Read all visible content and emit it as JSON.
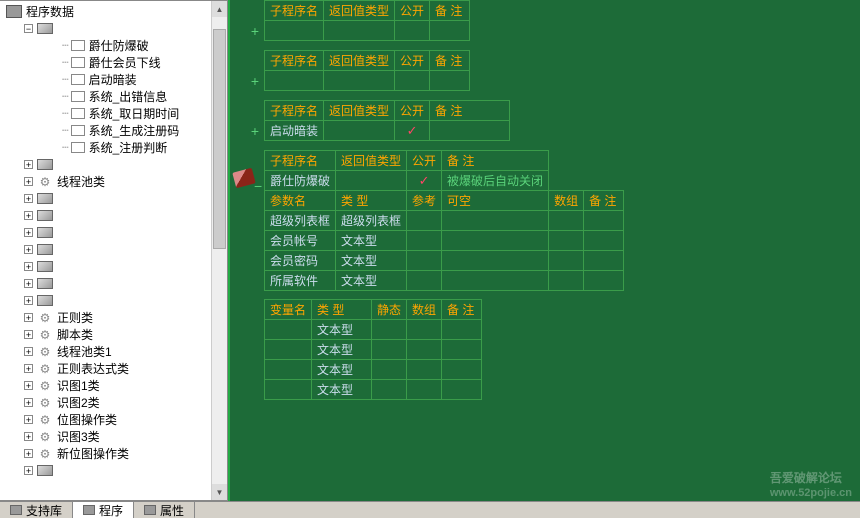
{
  "tree": {
    "root": "程序数据",
    "group1": {
      "items": [
        "爵仕防爆破",
        "爵仕会员下线",
        "启动暗装",
        "系统_出错信息",
        "系统_取日期时间",
        "系统_生成注册码",
        "系统_注册判断"
      ]
    },
    "threadClass": "线程池类",
    "blankItems": [
      "",
      "",
      "",
      "",
      "",
      "",
      ""
    ],
    "named": [
      "正则类",
      "脚本类",
      "线程池类1",
      "正则表达式类",
      "识图1类",
      "识图2类",
      "位图操作类",
      "识图3类",
      "新位图操作类"
    ]
  },
  "tables": {
    "subHeaders": {
      "name": "子程序名",
      "ret": "返回值类型",
      "pub": "公开",
      "rem": "备 注"
    },
    "t3": {
      "name": "启动暗装",
      "ret": "",
      "pub": "✓",
      "rem": ""
    },
    "t4": {
      "name": "爵仕防爆破",
      "ret": "",
      "pub": "✓",
      "rem": "被爆破后自动关闭"
    },
    "paramHeaders": {
      "name": "参数名",
      "type": "类 型",
      "ref": "参考",
      "null": "可空",
      "arr": "数组",
      "rem": "备 注"
    },
    "params": [
      {
        "name": "超级列表框",
        "type": "超级列表框"
      },
      {
        "name": "会员帐号",
        "type": "文本型"
      },
      {
        "name": "会员密码",
        "type": "文本型"
      },
      {
        "name": "所属软件",
        "type": "文本型"
      }
    ],
    "varHeaders": {
      "name": "变量名",
      "type": "类 型",
      "static": "静态",
      "arr": "数组",
      "rem": "备 注"
    },
    "vars": [
      "文本型",
      "文本型",
      "文本型",
      "文本型"
    ]
  },
  "tabs": {
    "support": "支持库",
    "prog": "程序",
    "prop": "属性"
  },
  "watermark": {
    "line1": "吾爱破解论坛",
    "line2": "www.52pojie.cn"
  }
}
